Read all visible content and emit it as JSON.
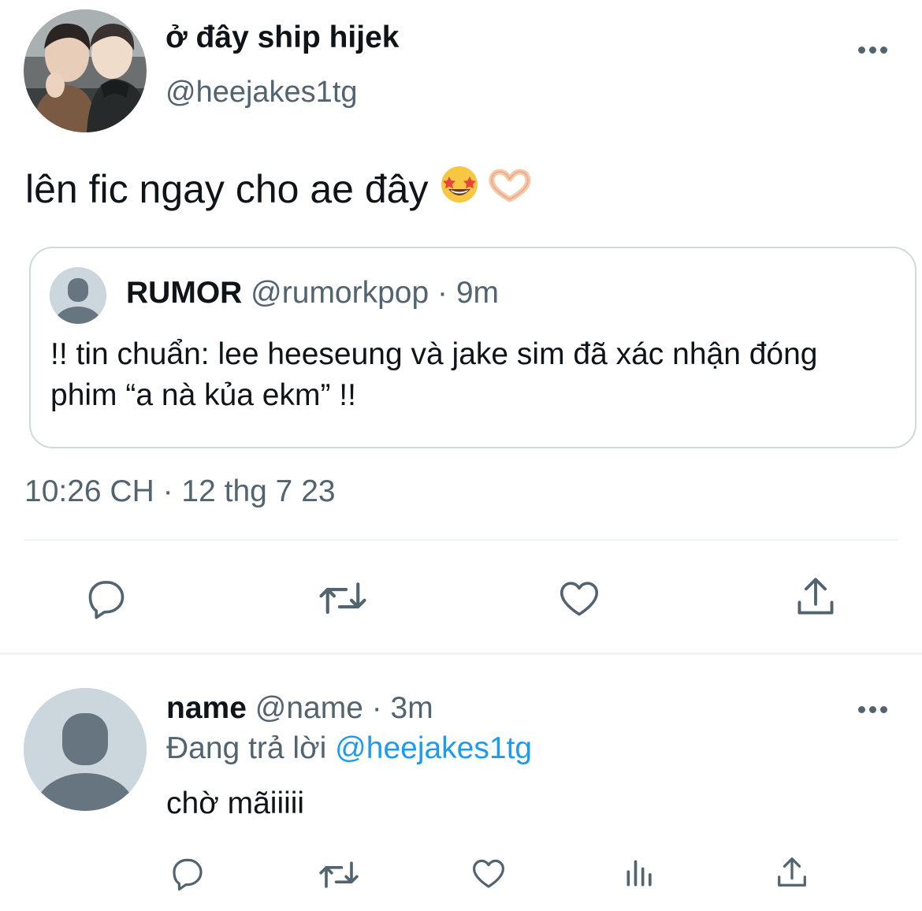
{
  "main_tweet": {
    "display_name": "ở đây ship hijek",
    "handle": "@heejakes1tg",
    "text": "lên fic ngay cho ae đây",
    "emojis": [
      "star-struck-emoji",
      "heart-hands-emoji"
    ],
    "more_icon": "more-horizontal-icon",
    "timestamp": "10:26 CH · 12 thg 7 23",
    "quote": {
      "display_name": "RUMOR",
      "meta": "@rumorkpop · 9m",
      "text": "!! tin chuẩn: lee heeseung và jake sim đã xác nhận đóng phim “a nà kủa ekm” !!"
    },
    "actions": [
      "reply-icon",
      "retweet-icon",
      "like-icon",
      "share-icon"
    ]
  },
  "reply": {
    "display_name": "name",
    "meta": "@name · 3m",
    "replying_prefix": "Đang trả lời ",
    "replying_mention": "@heejakes1tg",
    "text": "chờ mãiiiii",
    "more_icon": "more-horizontal-icon",
    "actions": [
      "reply-icon",
      "retweet-icon",
      "like-icon",
      "analytics-icon",
      "share-icon"
    ]
  },
  "colors": {
    "text_primary": "#0f1419",
    "text_secondary": "#536471",
    "accent": "#1d9bf0",
    "border": "#cfd9de",
    "avatar_placeholder": "#ccd6dd"
  }
}
